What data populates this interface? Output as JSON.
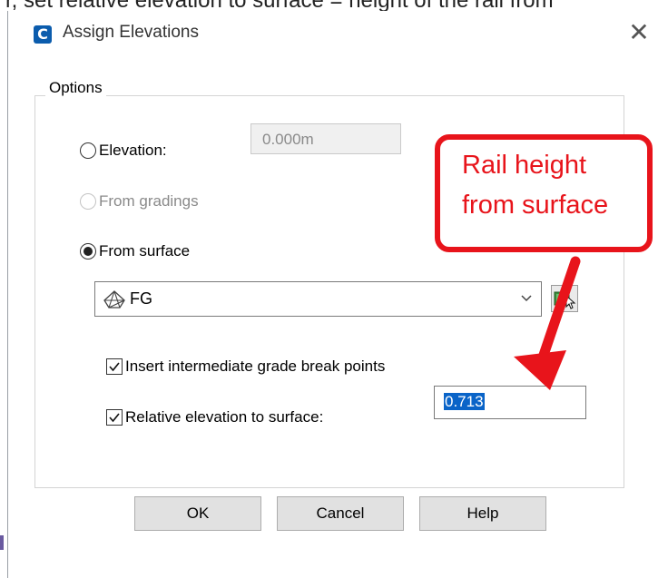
{
  "top_strip": {
    "text": "r, set relative elevation to surface = height of the rail from"
  },
  "window": {
    "title": "Assign Elevations",
    "app_icon_letter": "C",
    "close_glyph": "✕"
  },
  "options": {
    "legend": "Options",
    "elevation": {
      "label": "Elevation:",
      "selected": false,
      "value": "0.000m"
    },
    "from_gradings": {
      "label": "From gradings",
      "selected": false,
      "enabled": false
    },
    "from_surface": {
      "label": "From surface",
      "selected": true
    },
    "surface_dropdown": {
      "selected": "FG",
      "icon": "surface-tin-icon"
    },
    "insert_breakpoints": {
      "label": "Insert intermediate grade break points",
      "checked": true
    },
    "relative_elevation": {
      "label": "Relative elevation to surface:",
      "checked": true,
      "value": "0.713"
    }
  },
  "buttons": {
    "ok": "OK",
    "cancel": "Cancel",
    "help": "Help"
  },
  "annotation": {
    "line1": "Rail height",
    "line2": "from surface",
    "color": "#e8141b"
  }
}
